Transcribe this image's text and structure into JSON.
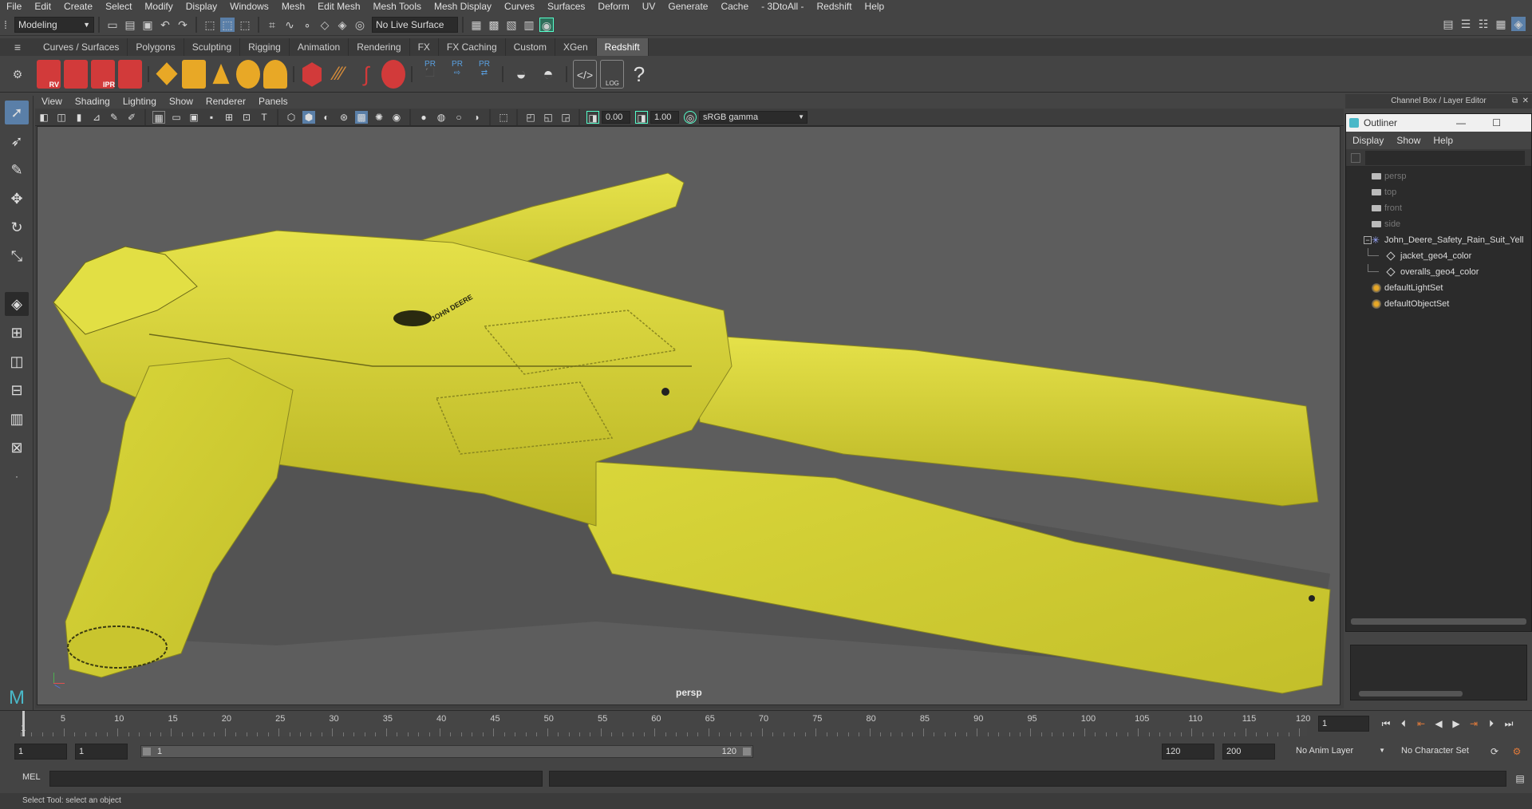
{
  "menubar": {
    "items": [
      "File",
      "Edit",
      "Create",
      "Select",
      "Modify",
      "Display",
      "Windows",
      "Mesh",
      "Edit Mesh",
      "Mesh Tools",
      "Mesh Display",
      "Curves",
      "Surfaces",
      "Deform",
      "UV",
      "Generate",
      "Cache",
      "- 3DtoAll -",
      "Redshift",
      "Help"
    ]
  },
  "statusline": {
    "mode": "Modeling",
    "live_surface": "No Live Surface"
  },
  "shelf": {
    "tabs": [
      "Curves / Surfaces",
      "Polygons",
      "Sculpting",
      "Rigging",
      "Animation",
      "Rendering",
      "FX",
      "FX Caching",
      "Custom",
      "XGen",
      "Redshift"
    ],
    "active_tab": "Redshift",
    "icon_labels": [
      "RV",
      "IPR",
      "PR",
      "PR",
      "PR",
      "LOG"
    ]
  },
  "panel": {
    "menu": [
      "View",
      "Shading",
      "Lighting",
      "Show",
      "Renderer",
      "Panels"
    ],
    "exposure": "0.00",
    "gamma": "1.00",
    "color_space": "sRGB gamma",
    "camera_name": "persp"
  },
  "channel_box_title": "Channel Box / Layer Editor",
  "outliner": {
    "title": "Outliner",
    "menu": [
      "Display",
      "Show",
      "Help"
    ],
    "items": [
      {
        "label": "persp",
        "type": "camera",
        "indent": 0,
        "dim": true
      },
      {
        "label": "top",
        "type": "camera",
        "indent": 0,
        "dim": true
      },
      {
        "label": "front",
        "type": "camera",
        "indent": 0,
        "dim": true
      },
      {
        "label": "side",
        "type": "camera",
        "indent": 0,
        "dim": true
      },
      {
        "label": "John_Deere_Safety_Rain_Suit_Yell",
        "type": "group",
        "indent": 0,
        "dim": false
      },
      {
        "label": "jacket_geo4_color",
        "type": "mesh",
        "indent": 1,
        "dim": false
      },
      {
        "label": "overalls_geo4_color",
        "type": "mesh",
        "indent": 1,
        "dim": false
      },
      {
        "label": "defaultLightSet",
        "type": "set",
        "indent": 0,
        "dim": false
      },
      {
        "label": "defaultObjectSet",
        "type": "set",
        "indent": 0,
        "dim": false
      }
    ]
  },
  "timeline": {
    "ticks": [
      "5",
      "10",
      "15",
      "20",
      "25",
      "30",
      "35",
      "40",
      "45",
      "50",
      "55",
      "60",
      "65",
      "70",
      "75",
      "80",
      "85",
      "90",
      "95",
      "100",
      "105",
      "110",
      "115",
      "120"
    ],
    "first_tick": "1",
    "current_frame": "1"
  },
  "range": {
    "start": "1",
    "playback_start": "1",
    "slider_start": "1",
    "slider_end": "120",
    "playback_end": "120",
    "end": "200",
    "anim_layer": "No Anim Layer",
    "character_set": "No Character Set"
  },
  "cmdline": {
    "label": "MEL"
  },
  "helpline": {
    "text": "Select Tool: select an object"
  },
  "viewport_logo_text": "JOHN DEERE",
  "colors": {
    "suit": "#d9d63a",
    "viewport_bg": "#5d5d5d",
    "accent": "#4ab8c8"
  }
}
